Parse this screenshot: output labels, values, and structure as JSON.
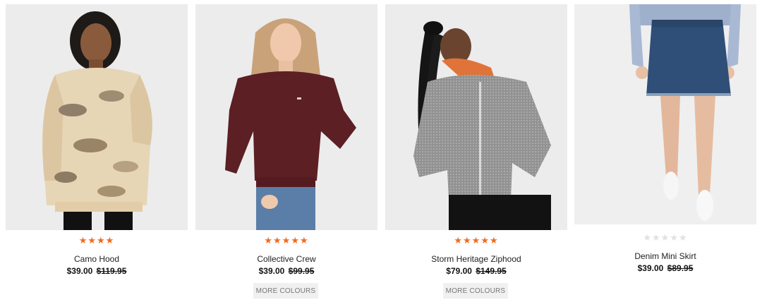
{
  "products": [
    {
      "name": "Camo Hood",
      "rating": 4,
      "price": "$39.00",
      "was_price": "$119.95",
      "more_colours_label": "",
      "image_alt": "camo-hoodie-model",
      "bg_color": "#ececec"
    },
    {
      "name": "Collective Crew",
      "rating": 4.5,
      "price": "$39.00",
      "was_price": "$99.95",
      "more_colours_label": "MORE COLOURS",
      "image_alt": "burgundy-crew-model",
      "bg_color": "#ececec"
    },
    {
      "name": "Storm Heritage Ziphood",
      "rating": 4.5,
      "price": "$79.00",
      "was_price": "$149.95",
      "more_colours_label": "MORE COLOURS",
      "image_alt": "grey-ziphood-model",
      "bg_color": "#ececec"
    },
    {
      "name": "Denim Mini Skirt",
      "rating": 0,
      "price": "$39.00",
      "was_price": "$89.95",
      "more_colours_label": "",
      "image_alt": "denim-skirt-model",
      "bg_color": "#efefef"
    }
  ],
  "colors": {
    "star_filled": "#f26a1b",
    "star_empty": "#e1e1e1",
    "button_bg": "#f0f0f0",
    "button_text": "#777777"
  }
}
